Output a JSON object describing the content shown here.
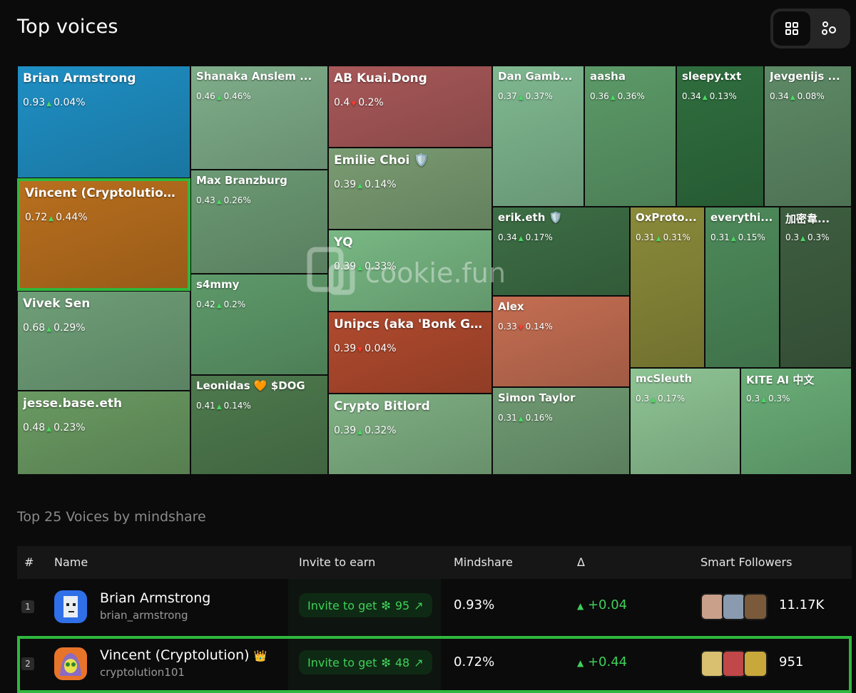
{
  "header": {
    "title": "Top voices"
  },
  "view_toggle": {
    "grid_icon": "grid-icon",
    "graph_icon": "nodes-icon"
  },
  "treemap": {
    "tiles": [
      {
        "name": "Brian Armstrong",
        "score": "0.93",
        "trend": "up",
        "change": "0.04%",
        "color": "#1f8fc4"
      },
      {
        "name": "Vincent (Cryptolution)...",
        "score": "0.72",
        "trend": "up",
        "change": "0.44%",
        "color": "#b96f1e"
      },
      {
        "name": "Vivek Sen",
        "score": "0.68",
        "trend": "up",
        "change": "0.29%",
        "color": "#6f9f78"
      },
      {
        "name": "jesse.base.eth",
        "score": "0.48",
        "trend": "up",
        "change": "0.23%",
        "color": "#6a9a62"
      },
      {
        "name": "Shanaka Anslem ...",
        "score": "0.46",
        "trend": "up",
        "change": "0.46%",
        "color": "#7fae8a"
      },
      {
        "name": "Max Branzburg",
        "score": "0.43",
        "trend": "up",
        "change": "0.26%",
        "color": "#6c9a74"
      },
      {
        "name": "s4mmy",
        "score": "0.42",
        "trend": "up",
        "change": "0.2%",
        "color": "#5e9a6a"
      },
      {
        "name": "Leonidas 🧡 $DOG",
        "score": "0.41",
        "trend": "up",
        "change": "0.14%",
        "color": "#4e7a4e"
      },
      {
        "name": "AB Kuai.Dong",
        "score": "0.4",
        "trend": "down",
        "change": "0.2%",
        "color": "#a85858"
      },
      {
        "name": "Emilie Choi 🛡️",
        "score": "0.39",
        "trend": "up",
        "change": "0.14%",
        "color": "#7a9c72"
      },
      {
        "name": "YQ",
        "score": "0.39",
        "trend": "up",
        "change": "0.33%",
        "color": "#78b884"
      },
      {
        "name": "Unipcs (aka 'Bonk Gu...",
        "score": "0.39",
        "trend": "down",
        "change": "0.04%",
        "color": "#b04a2e"
      },
      {
        "name": "Crypto Bitlord",
        "score": "0.39",
        "trend": "up",
        "change": "0.32%",
        "color": "#7fb083"
      },
      {
        "name": "Dan Gamb...",
        "score": "0.37",
        "trend": "up",
        "change": "0.37%",
        "color": "#7fb890"
      },
      {
        "name": "aasha",
        "score": "0.36",
        "trend": "up",
        "change": "0.36%",
        "color": "#5c9a68"
      },
      {
        "name": "sleepy.txt",
        "score": "0.34",
        "trend": "up",
        "change": "0.13%",
        "color": "#2f6e3e"
      },
      {
        "name": "Jevgenijs ...",
        "score": "0.34",
        "trend": "up",
        "change": "0.08%",
        "color": "#5e8a66"
      },
      {
        "name": "erik.eth 🛡️",
        "score": "0.34",
        "trend": "up",
        "change": "0.17%",
        "color": "#3d6e45"
      },
      {
        "name": "Alex",
        "score": "0.33",
        "trend": "down",
        "change": "0.14%",
        "color": "#c46e52"
      },
      {
        "name": "Simon Taylor",
        "score": "0.31",
        "trend": "up",
        "change": "0.16%",
        "color": "#6f9a72"
      },
      {
        "name": "OxProto...",
        "score": "0.31",
        "trend": "up",
        "change": "0.31%",
        "color": "#8a8a3a"
      },
      {
        "name": "everythi...",
        "score": "0.31",
        "trend": "up",
        "change": "0.15%",
        "color": "#4d8a5a"
      },
      {
        "name": "加密韋...",
        "score": "0.3",
        "trend": "up",
        "change": "0.3%",
        "color": "#3e5e40"
      },
      {
        "name": "mcSleuth",
        "score": "0.3",
        "trend": "up",
        "change": "0.17%",
        "color": "#8ec494"
      },
      {
        "name": "KITE AI 中文",
        "score": "0.3",
        "trend": "up",
        "change": "0.3%",
        "color": "#6aae78"
      }
    ]
  },
  "watermark": {
    "text": "cookie.fun"
  },
  "section": {
    "subtitle": "Top 25 Voices by mindshare"
  },
  "table": {
    "columns": [
      "#",
      "Name",
      "Invite to earn",
      "Mindshare",
      "Δ",
      "Smart Followers"
    ],
    "rows": [
      {
        "rank": "1",
        "name": "Brian Armstrong",
        "handle": "brian_armstrong",
        "invite": "Invite to get",
        "invite_amount": "95",
        "mindshare": "0.93%",
        "delta": "+0.04",
        "followers": "11.17K",
        "avatar_color": "#2f6fe8"
      },
      {
        "rank": "2",
        "name": "Vincent (Cryptolution)",
        "handle": "cryptolution101",
        "invite": "Invite to get",
        "invite_amount": "48",
        "mindshare": "0.72%",
        "delta": "+0.44",
        "followers": "951",
        "avatar_color": "#e8742a",
        "crown": "👑"
      }
    ]
  }
}
